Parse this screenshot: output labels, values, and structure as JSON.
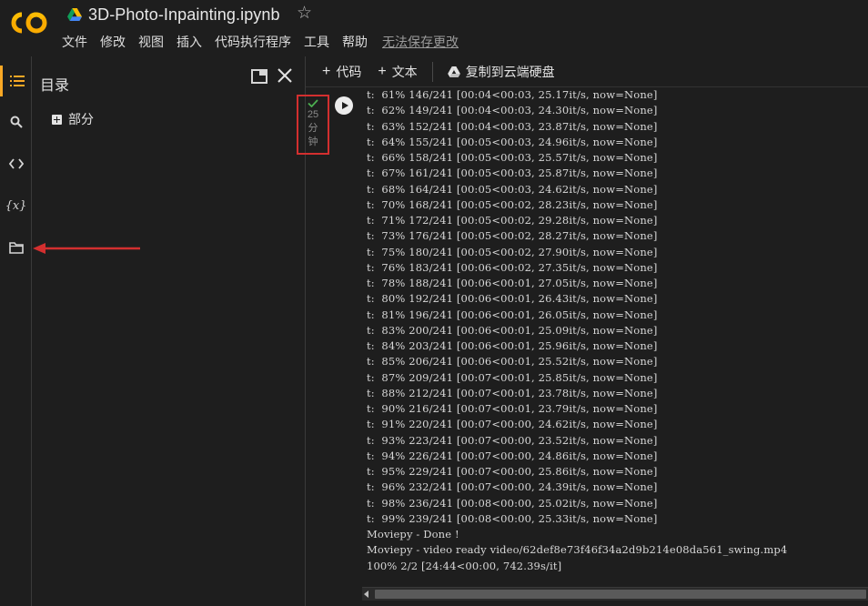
{
  "app": {
    "title": "3D-Photo-Inpainting.ipynb",
    "logo": "colab-logo",
    "brand_colors": {
      "orange": "#f9ab00",
      "yellow": "#fbbc04"
    }
  },
  "menu": {
    "items": [
      "文件",
      "修改",
      "视图",
      "插入",
      "代码执行程序",
      "工具",
      "帮助"
    ],
    "unsaved_notice": "无法保存更改"
  },
  "rail": {
    "icons": [
      "toc-icon",
      "search-icon",
      "code-snippets-icon",
      "variables-icon",
      "folder-icon"
    ],
    "variables_label": "{x}"
  },
  "toc": {
    "title": "目录",
    "section_label": "部分"
  },
  "toolbar": {
    "add_code": "代码",
    "add_text": "文本",
    "copy_to_drive": "复制到云端硬盘",
    "plus": "+"
  },
  "cell": {
    "exec_time": [
      "25",
      "分",
      "钟"
    ],
    "output_lines": [
      "t:  61% 146/241 [00:04<00:03, 25.17it/s, now=None]",
      "t:  62% 149/241 [00:04<00:03, 24.30it/s, now=None]",
      "t:  63% 152/241 [00:04<00:03, 23.87it/s, now=None]",
      "t:  64% 155/241 [00:05<00:03, 24.96it/s, now=None]",
      "t:  66% 158/241 [00:05<00:03, 25.57it/s, now=None]",
      "t:  67% 161/241 [00:05<00:03, 25.87it/s, now=None]",
      "t:  68% 164/241 [00:05<00:03, 24.62it/s, now=None]",
      "t:  70% 168/241 [00:05<00:02, 28.23it/s, now=None]",
      "t:  71% 172/241 [00:05<00:02, 29.28it/s, now=None]",
      "t:  73% 176/241 [00:05<00:02, 28.27it/s, now=None]",
      "t:  75% 180/241 [00:05<00:02, 27.90it/s, now=None]",
      "t:  76% 183/241 [00:06<00:02, 27.35it/s, now=None]",
      "t:  78% 188/241 [00:06<00:01, 27.05it/s, now=None]",
      "t:  80% 192/241 [00:06<00:01, 26.43it/s, now=None]",
      "t:  81% 196/241 [00:06<00:01, 26.05it/s, now=None]",
      "t:  83% 200/241 [00:06<00:01, 25.09it/s, now=None]",
      "t:  84% 203/241 [00:06<00:01, 25.96it/s, now=None]",
      "t:  85% 206/241 [00:06<00:01, 25.52it/s, now=None]",
      "t:  87% 209/241 [00:07<00:01, 25.85it/s, now=None]",
      "t:  88% 212/241 [00:07<00:01, 23.78it/s, now=None]",
      "t:  90% 216/241 [00:07<00:01, 23.79it/s, now=None]",
      "t:  91% 220/241 [00:07<00:00, 24.62it/s, now=None]",
      "t:  93% 223/241 [00:07<00:00, 23.52it/s, now=None]",
      "t:  94% 226/241 [00:07<00:00, 24.86it/s, now=None]",
      "t:  95% 229/241 [00:07<00:00, 25.86it/s, now=None]",
      "t:  96% 232/241 [00:07<00:00, 24.39it/s, now=None]",
      "t:  98% 236/241 [00:08<00:00, 25.02it/s, now=None]",
      "t:  99% 239/241 [00:08<00:00, 25.33it/s, now=None]",
      "Moviepy - Done !",
      "Moviepy - video ready video/62def8e73f46f34a2d9b214e08da561_swing.mp4",
      "100% 2/2 [24:44<00:00, 742.39s/it]"
    ]
  },
  "annotations": {
    "highlight_color": "#d32f2f"
  }
}
